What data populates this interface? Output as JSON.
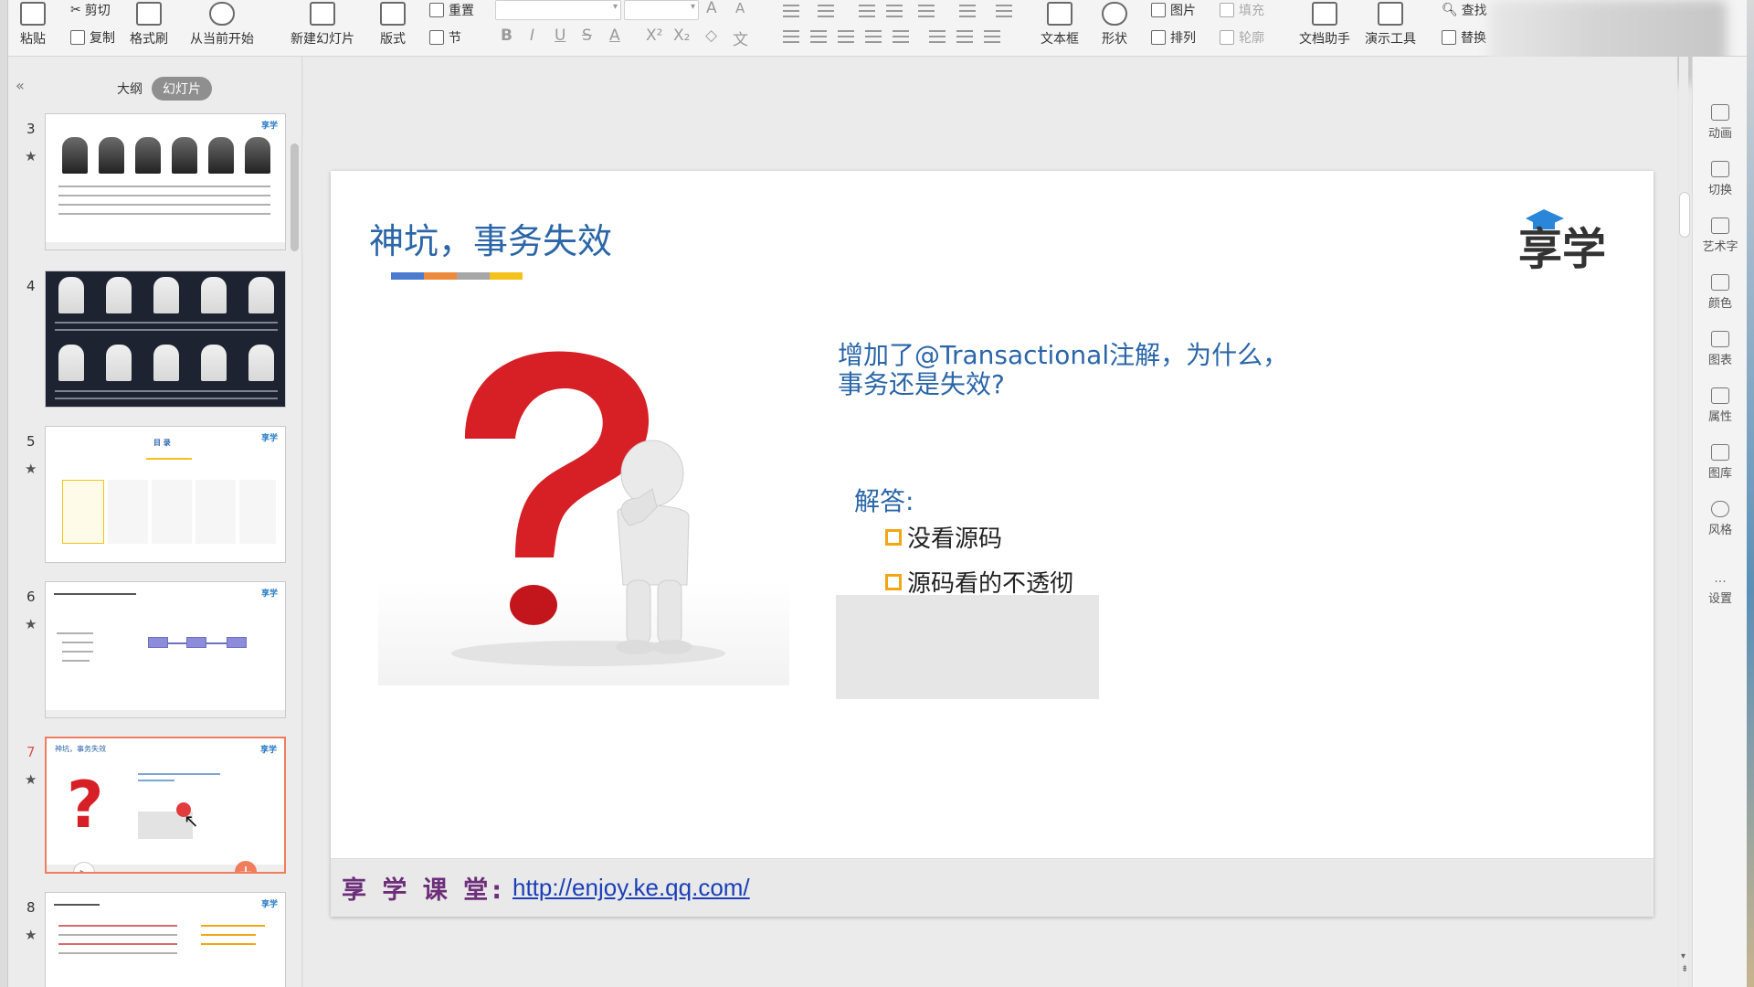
{
  "ribbon": {
    "paste": "粘贴",
    "cut": "剪切",
    "copy": "复制",
    "format_painter": "格式刷",
    "from_current": "从当前开始",
    "new_slide": "新建幻灯片",
    "layout": "版式",
    "reset": "重置",
    "section": "节",
    "text_box": "文本框",
    "shape": "形状",
    "picture": "图片",
    "fill": "填充",
    "arrange": "排列",
    "outline": "轮廓",
    "doc_assistant": "文档助手",
    "present_tools": "演示工具",
    "find": "查找",
    "replace": "替换"
  },
  "pane": {
    "tab_outline": "大纲",
    "tab_slides": "幻灯片",
    "slide_numbers": [
      "3",
      "4",
      "5",
      "6",
      "7",
      "8"
    ],
    "active_slide": "7"
  },
  "right_pane": {
    "items": [
      "动画",
      "切换",
      "艺术字",
      "颜色",
      "图表",
      "属性",
      "图库",
      "风格",
      "设置"
    ]
  },
  "slide": {
    "title": "神坑，事务失效",
    "logo_text": "享学",
    "question": "增加了@Transactional注解，为什么，事务还是失效?",
    "answer_label": "解答:",
    "bullets": [
      "没看源码",
      "源码看的不透彻"
    ],
    "footer_label": "享 学 课 堂:",
    "footer_link": "http://enjoy.ke.qq.com/"
  },
  "colors": {
    "title_blue": "#2a66a8",
    "bar": [
      "#4a7bd0",
      "#ee8a3c",
      "#a6a6a6",
      "#f4c21a"
    ],
    "bullet_box": "#f2a613",
    "footer_label": "#6d2e7a",
    "link": "#1a3fb8",
    "active_thumb": "#f07d5c"
  }
}
